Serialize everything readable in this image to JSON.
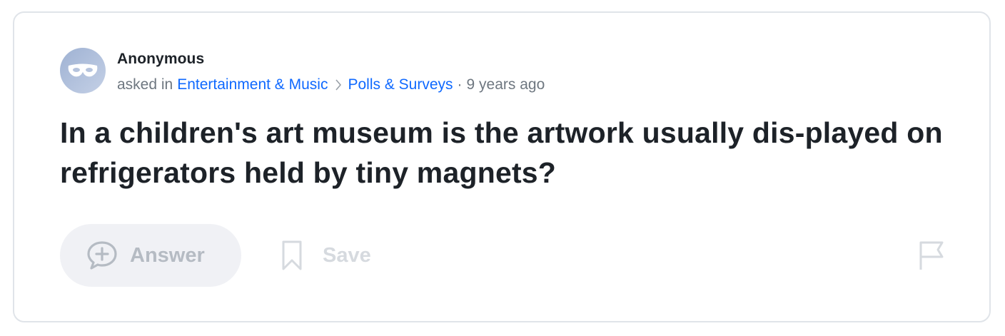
{
  "question": {
    "author": "Anonymous",
    "asked_prefix": "asked in",
    "category": "Entertainment & Music",
    "subcategory": "Polls & Surveys",
    "separator": "·",
    "age": "9 years ago",
    "title": "In a children's art museum is the artwork usually dis-played on refrigerators held by tiny magnets?"
  },
  "actions": {
    "answer_label": "Answer",
    "save_label": "Save"
  },
  "icons": {
    "avatar": "anonymous-mask-icon",
    "breadcrumb_separator": "chevron-right-icon",
    "answer": "plus-speech-bubble-icon",
    "save": "bookmark-icon",
    "report": "flag-icon"
  },
  "colors": {
    "link": "#0f69ff",
    "title": "#1d2228",
    "muted": "#6e7780",
    "button_bg": "#f0f1f5",
    "card_border": "#e0e4e9"
  }
}
